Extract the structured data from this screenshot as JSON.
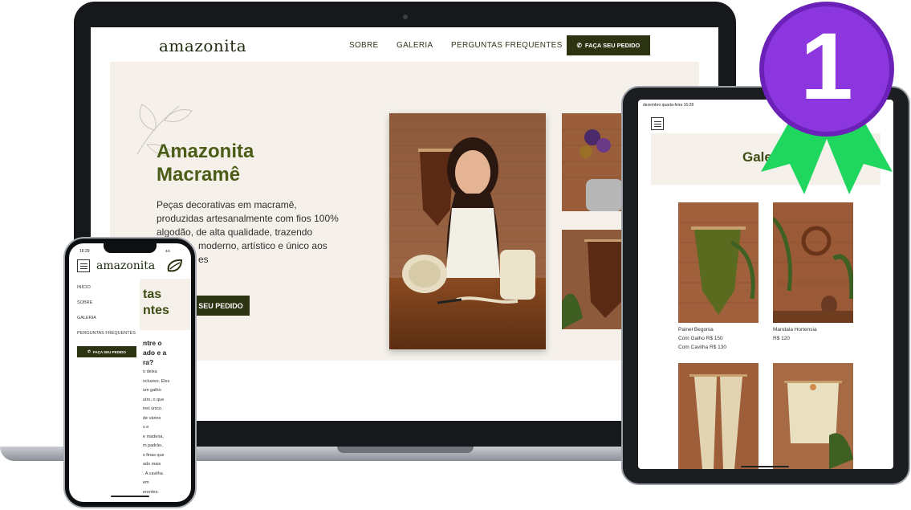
{
  "laptop_site": {
    "logo": "amazonita",
    "nav": [
      {
        "label": "SOBRE"
      },
      {
        "label": "GALERIA"
      },
      {
        "label": "PERGUNTAS FREQUENTES"
      }
    ],
    "cta_label": "FAÇA SEU PEDIDO",
    "hero": {
      "title_line1": "Amazonita",
      "title_line2": "Macramê",
      "desc_line1": "Peças decorativas em macramê,",
      "desc_line2": "produzidas artesanalmente com fios 100%",
      "desc_line3": "algodão, de alta qualidade, trazendo",
      "desc_line4": "moderno, artístico e único aos",
      "desc_line5": "es",
      "button_label": "SEU PEDIDO"
    }
  },
  "tablet_site": {
    "status_time": "dezembro quarta-feira 16:28",
    "hero_title": "Gale",
    "products": [
      {
        "name": "Painel Begonia",
        "price1": "Com Galho R$ 150",
        "price2": "Com Cavilha R$ 130"
      },
      {
        "name": "Mandala Hortensia",
        "price1": "R$ 120",
        "price2": ""
      }
    ]
  },
  "phone_site": {
    "status_time": "16:29",
    "status_signal": "4G",
    "logo": "amazonita",
    "menu": [
      {
        "label": "INÍCIO"
      },
      {
        "label": "SOBRE"
      },
      {
        "label": "GALERIA"
      },
      {
        "label": "PERGUNTAS FREQUENTES"
      }
    ],
    "cta_label": "FAÇA SEU PEDIDO",
    "behind_title_line1": "tas",
    "behind_title_line2": "ntes",
    "behind_q_line1": "ntre o",
    "behind_q_line2": "ado e a",
    "behind_q_line3": "ra?",
    "behind_body": [
      "o deixa",
      "xclusivo. Eles",
      "um galho",
      "utro, o que",
      "inel único.",
      "de vários",
      "s e",
      "e madeira,",
      "m padrão,",
      "s finas que",
      "ado mais",
      ". A cavilha",
      "em",
      "erentes."
    ]
  },
  "badge": {
    "number": "1"
  },
  "colors": {
    "brand_dark": "#2b3311",
    "brand_green": "#4a5c16",
    "hero_bg": "#f5f1ea",
    "ribbon_green": "#1fd65f",
    "badge_purple": "#8c36e0"
  }
}
